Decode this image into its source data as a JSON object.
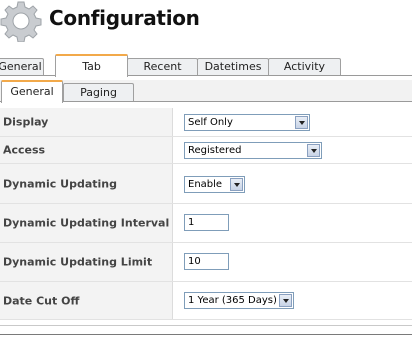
{
  "page": {
    "title": "Configuration",
    "icon": "gear-icon"
  },
  "tabs": [
    {
      "label": "General",
      "active": false
    },
    {
      "label": "Tab",
      "active": true
    },
    {
      "label": "Recent",
      "active": false
    },
    {
      "label": "Datetimes",
      "active": false
    },
    {
      "label": "Activity",
      "active": false
    }
  ],
  "subtabs": [
    {
      "label": "General",
      "active": true
    },
    {
      "label": "Paging",
      "active": false
    }
  ],
  "form": {
    "display": {
      "label": "Display",
      "value": "Self Only"
    },
    "access": {
      "label": "Access",
      "value": "Registered"
    },
    "dynamic_updating": {
      "label": "Dynamic Updating",
      "value": "Enable"
    },
    "dynamic_updating_interval": {
      "label": "Dynamic Updating Interval",
      "value": "1"
    },
    "dynamic_updating_limit": {
      "label": "Dynamic Updating Limit",
      "value": "10"
    },
    "date_cut_off": {
      "label": "Date Cut Off",
      "value": "1 Year (365 Days)"
    }
  },
  "colors": {
    "active_tab_accent": "#f2a94a",
    "label_bg": "#f3f3f3",
    "field_border": "#7f9db9"
  }
}
